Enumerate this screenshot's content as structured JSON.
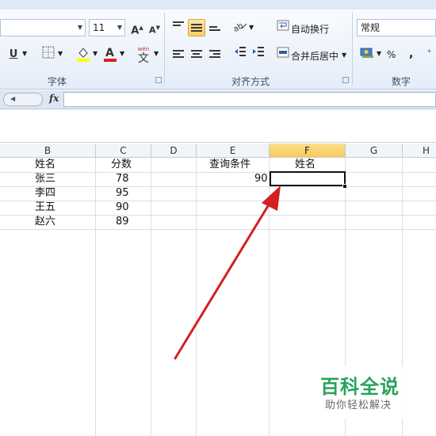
{
  "ribbon": {
    "font_size": "11",
    "wrap_text_label": "自动换行",
    "merge_center_label": "合并后居中",
    "number_format": "常规",
    "percent_symbol": "%",
    "comma_symbol": ",",
    "group_font": "字体",
    "group_alignment": "对齐方式",
    "group_number": "数字",
    "phonetic_top": "wén",
    "phonetic_char": "文"
  },
  "formula_bar": {
    "fx_label": "fx",
    "value": ""
  },
  "columns": [
    "B",
    "C",
    "D",
    "E",
    "F",
    "G",
    "H"
  ],
  "active_column": "F",
  "table": {
    "headers": [
      "姓名",
      "分数"
    ],
    "rows": [
      [
        "张三",
        "78"
      ],
      [
        "李四",
        "95"
      ],
      [
        "王五",
        "90"
      ],
      [
        "赵六",
        "89"
      ]
    ]
  },
  "query": {
    "label": "查询条件",
    "result_label": "姓名",
    "value": "90",
    "result_value": ""
  },
  "watermark": {
    "title": "百科全说",
    "subtitle": "助你轻松解决"
  },
  "colors": {
    "arrow": "#d32020",
    "active_header": "#f8c95a",
    "watermark": "#27a35a"
  }
}
